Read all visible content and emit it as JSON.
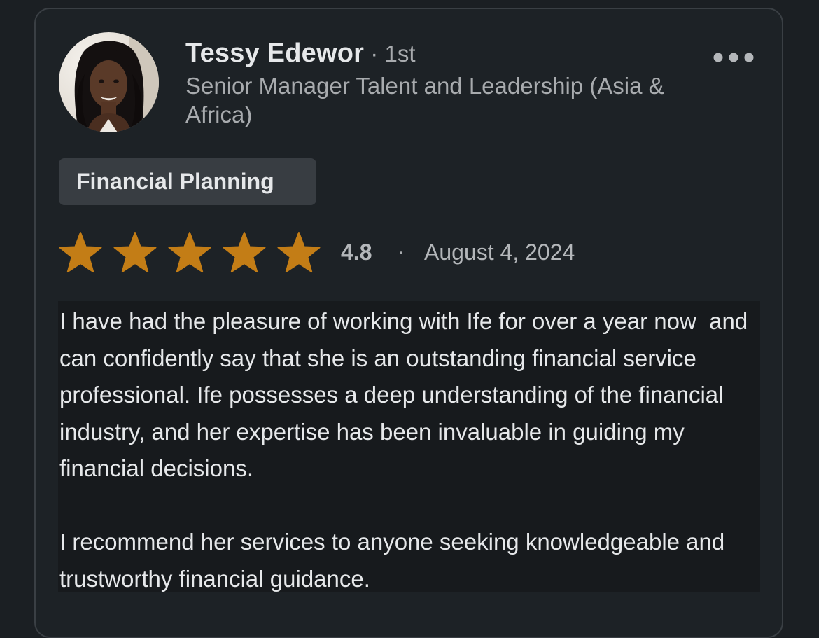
{
  "review": {
    "reviewer_name": "Tessy Edewor",
    "connection_degree": " · 1st",
    "headline": "Senior Manager Talent and Leadership (Asia & Africa)",
    "more_icon": "more-horizontal-icon",
    "service_tag": "Financial Planning",
    "rating": {
      "value_text": "4.8",
      "value": 4.8,
      "max": 5,
      "star_color": "#c37d16",
      "separator": "·",
      "date": "August 4, 2024"
    },
    "body_paragraphs": [
      "I have had the pleasure of working with Ife for over a year now  and can confidently say that she is an outstanding financial service professional. Ife possesses a deep understanding of the financial industry, and her expertise has been invaluable in guiding my financial decisions.",
      "I recommend her services to anyone seeking knowledgeable and trustworthy financial guidance."
    ]
  }
}
